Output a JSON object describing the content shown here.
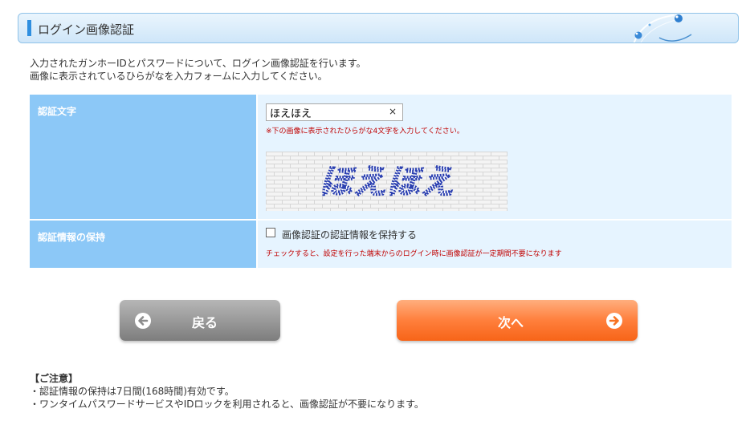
{
  "header": {
    "title": "ログイン画像認証"
  },
  "intro": [
    "入力されたガンホーIDとパスワードについて、ログイン画像認証を行います。",
    "画像に表示されているひらがなを入力フォームに入力してください。"
  ],
  "captcha_row": {
    "label": "認証文字",
    "input_value": "ほえほえ",
    "clear_symbol": "×",
    "note": "※下の画像に表示されたひらがな4文字を入力してください。",
    "image_text": "ほえほえ"
  },
  "retain_row": {
    "label": "認証情報の保持",
    "checkbox_label": "画像認証の認証情報を保持する",
    "checked": false,
    "note": "チェックすると、設定を行った端末からのログイン時に画像認証が一定期間不要になります"
  },
  "buttons": {
    "back": "戻る",
    "next": "次へ"
  },
  "caution": {
    "title": "【ご注意】",
    "lines": [
      "・認証情報の保持は7日間(168時間)有効です。",
      "・ワンタイムパスワードサービスやIDロックを利用されると、画像認証が不要になります。"
    ]
  },
  "colors": {
    "label_bg": "#8cc8f7",
    "value_bg": "#e6f4ff",
    "header_accent": "#2f8fe0",
    "note_red": "#c00000",
    "next_button": "#ff7f3c",
    "back_button": "#9a9a9a"
  },
  "icons": {
    "back": "arrow-left-circle-icon",
    "next": "arrow-right-circle-icon"
  }
}
